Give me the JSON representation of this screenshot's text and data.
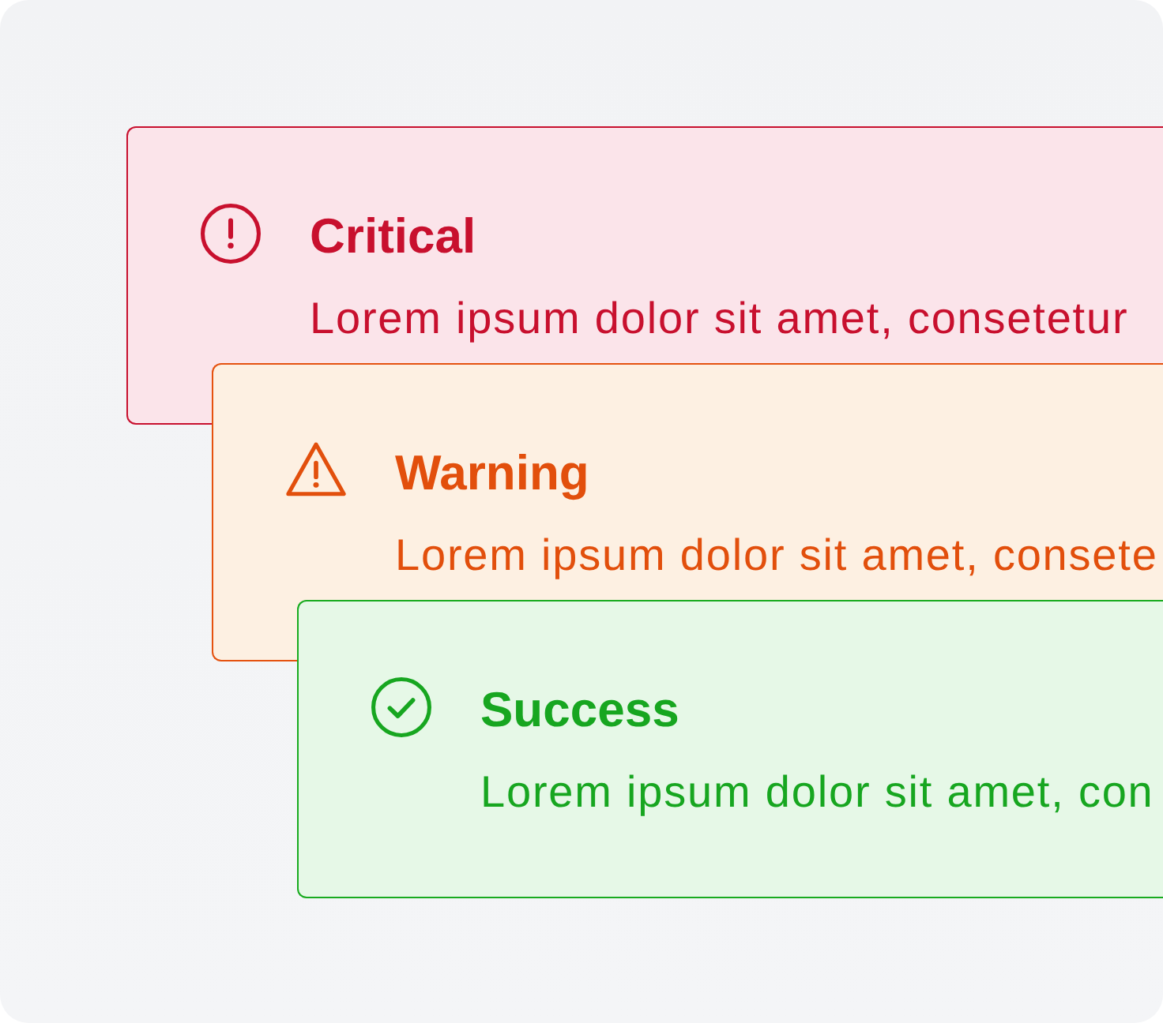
{
  "alerts": [
    {
      "kind": "critical",
      "title": "Critical",
      "message": "Lorem ipsum dolor sit amet, consetetur"
    },
    {
      "kind": "warning",
      "title": "Warning",
      "message": "Lorem ipsum dolor sit amet, consete"
    },
    {
      "kind": "success",
      "title": "Success",
      "message": "Lorem ipsum dolor sit amet, con"
    }
  ]
}
